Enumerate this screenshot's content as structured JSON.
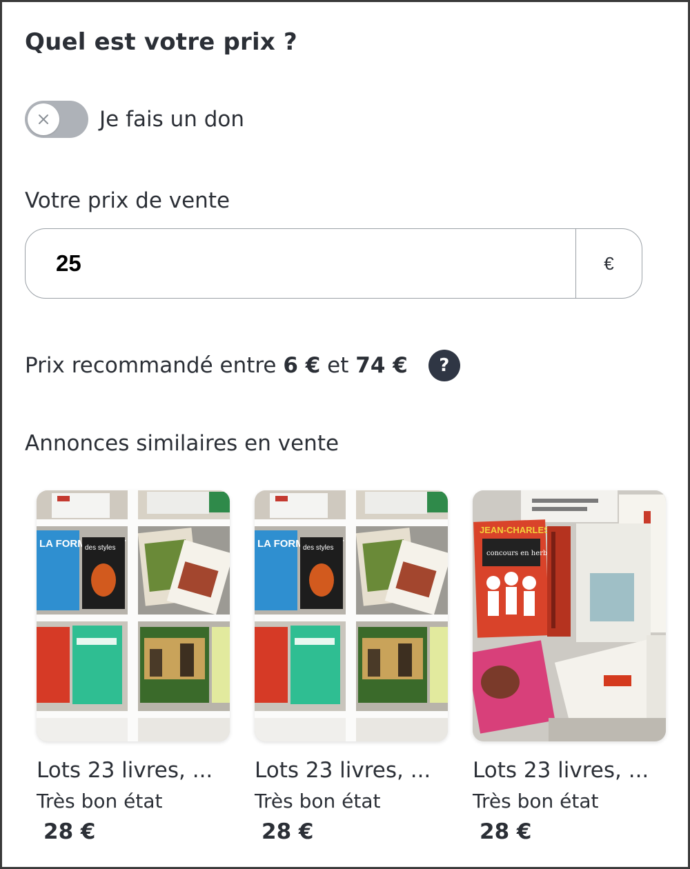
{
  "heading": "Quel est votre prix ?",
  "donation_toggle": {
    "label": "Je fais un don",
    "checked": false
  },
  "price_field": {
    "label": "Votre prix de vente",
    "value": "25",
    "currency": "€"
  },
  "recommendation": {
    "prefix": "Prix recommandé entre",
    "min": "6 €",
    "connector": "et",
    "max": "74 €"
  },
  "similar": {
    "title": "Annonces similaires en vente",
    "listings": [
      {
        "title": "Lots 23 livres, ...",
        "condition": "Très bon état",
        "price": "28 €"
      },
      {
        "title": "Lots 23 livres, ...",
        "condition": "Très bon état",
        "price": "28 €"
      },
      {
        "title": "Lots 23 livres, ...",
        "condition": "Très bon état",
        "price": "28 €"
      }
    ]
  },
  "photo_text": {
    "book_la_forme": "LA FORME C'EST FACILE",
    "book_des_styles": "des styles",
    "book_jean_charles": "JEAN-CHARLES",
    "book_concurs": "concours en herbe"
  },
  "icons": {
    "toggle": "close-icon",
    "help": "question-icon"
  },
  "colors": {
    "toggle_track": "#aeb2b8",
    "help_icon_bg": "#2f3644",
    "text": "#2b2f36"
  }
}
